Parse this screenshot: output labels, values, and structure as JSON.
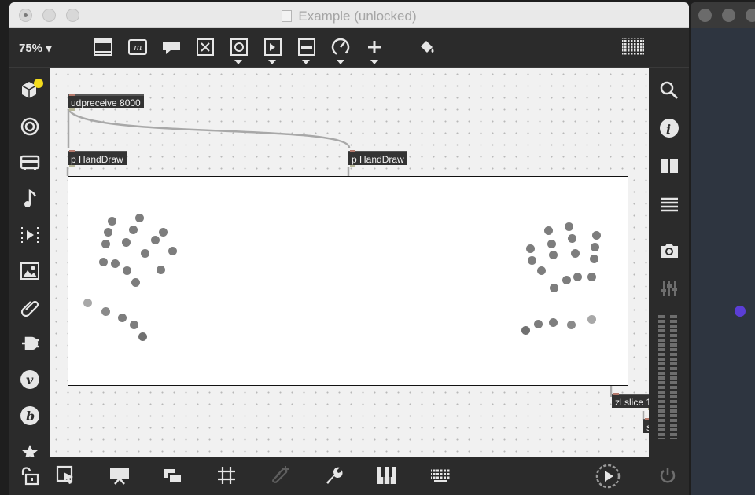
{
  "window": {
    "title": "Example (unlocked)",
    "zoom": "75% ▾"
  },
  "objects": {
    "udpreceive": "udpreceive 8000",
    "handdraw_left": "p HandDraw",
    "handdraw_right": "p HandDraw",
    "zl_slice": "zl slice 1",
    "partial": "se"
  },
  "toolbar": {
    "icons": [
      "presentation-icon",
      "message-icon",
      "comment-icon",
      "toggle-icon",
      "button-icon",
      "number-icon",
      "slider-icon",
      "dial-icon",
      "add-icon",
      "paint-bucket-icon",
      "grid-icon"
    ]
  },
  "left_sidebar": {
    "icons": [
      "cube-icon",
      "target-icon",
      "bus-icon",
      "music-note-icon",
      "play-icon",
      "image-icon",
      "paperclip-icon",
      "plug-icon",
      "v-icon",
      "b-icon",
      "star-icon"
    ]
  },
  "right_sidebar": {
    "icons": [
      "search-icon",
      "info-icon",
      "book-icon",
      "list-icon",
      "camera-icon",
      "mixer-icon",
      "level-meter-icon"
    ]
  },
  "bottom_bar": {
    "icons": [
      "lock-icon",
      "select-icon",
      "presentation-mode-icon",
      "windows-icon",
      "grid-icon",
      "snap-icon",
      "wrench-icon",
      "piano-icon",
      "keyboard-icon",
      "transport-icon",
      "power-icon"
    ]
  },
  "colors": {
    "canvas": "#f1f1f1",
    "object": "#333333",
    "dot_dark": "#7d7d7d",
    "dot_light": "#a8a8a8",
    "badge": "#f3dc1d",
    "purple_dot": "#5b3ed6"
  }
}
